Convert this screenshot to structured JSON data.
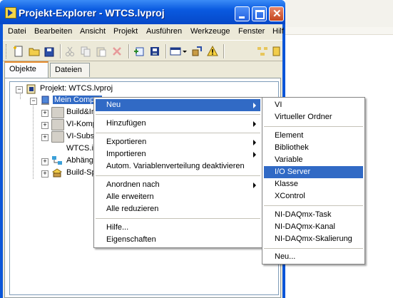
{
  "window": {
    "title": "Projekt-Explorer - WTCS.lvproj"
  },
  "menubar": {
    "items": [
      "Datei",
      "Bearbeiten",
      "Ansicht",
      "Projekt",
      "Ausführen",
      "Werkzeuge",
      "Fenster",
      "Hilf"
    ]
  },
  "tabs": {
    "items": [
      "Objekte",
      "Dateien"
    ]
  },
  "tree": {
    "root": "Projekt: WTCS.lvproj",
    "computer": "Mein Comput",
    "children": [
      "Build&In",
      "VI-Komp",
      "VI-Subs",
      "WTCS.ic",
      "Abhängi",
      "Build-Spe"
    ]
  },
  "context_menu": {
    "items": [
      "Neu",
      "Hinzufügen",
      "Exportieren",
      "Importieren",
      "Autom. Variablenverteilung deaktivieren",
      "Anordnen nach",
      "Alle erweitern",
      "Alle reduzieren",
      "Hilfe...",
      "Eigenschaften"
    ]
  },
  "submenu": {
    "items": [
      "VI",
      "Virtueller Ordner",
      "Element",
      "Bibliothek",
      "Variable",
      "I/O Server",
      "Klasse",
      "XControl",
      "NI-DAQmx-Task",
      "NI-DAQmx-Kanal",
      "NI-DAQmx-Skalierung",
      "Neu..."
    ]
  },
  "colors": {
    "title_blue": "#0a5ae0",
    "selection": "#316ac5",
    "menu_bg": "#ece9d8"
  }
}
